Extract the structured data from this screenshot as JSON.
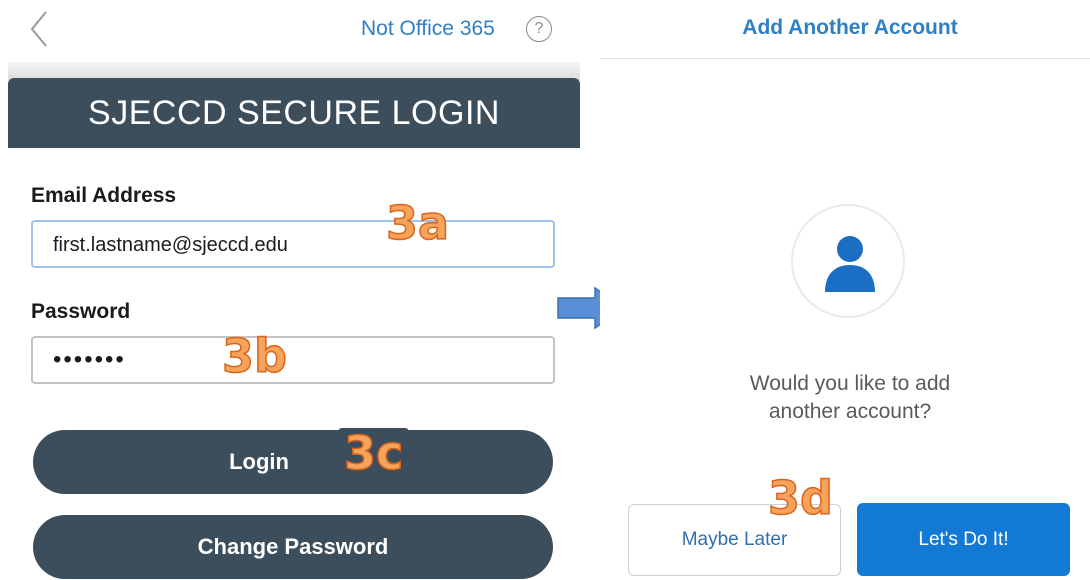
{
  "left": {
    "topbar": {
      "back_icon": "chevron-left-icon",
      "not_office_link": "Not Office 365",
      "help_icon_glyph": "?"
    },
    "banner_title": "SJECCD SECURE LOGIN",
    "email": {
      "label": "Email Address",
      "value": "first.lastname@sjeccd.edu"
    },
    "password": {
      "label": "Password",
      "value": "•••••••"
    },
    "login_button": "Login",
    "change_password_button": "Change Password"
  },
  "annotations": {
    "step_3a": "3a",
    "step_3b": "3b",
    "step_3c": "3c",
    "step_3d": "3d"
  },
  "right": {
    "title": "Add Another Account",
    "avatar_icon": "person-icon",
    "question_line1": "Would you like to add",
    "question_line2": "another account?",
    "maybe_later_button": "Maybe Later",
    "lets_do_it_button": "Let's Do It!"
  },
  "colors": {
    "accent_blue": "#2f7fc4",
    "banner_dark": "#3c4d5c",
    "primary_button": "#1279d4",
    "step_orange": "#f7a35c"
  }
}
